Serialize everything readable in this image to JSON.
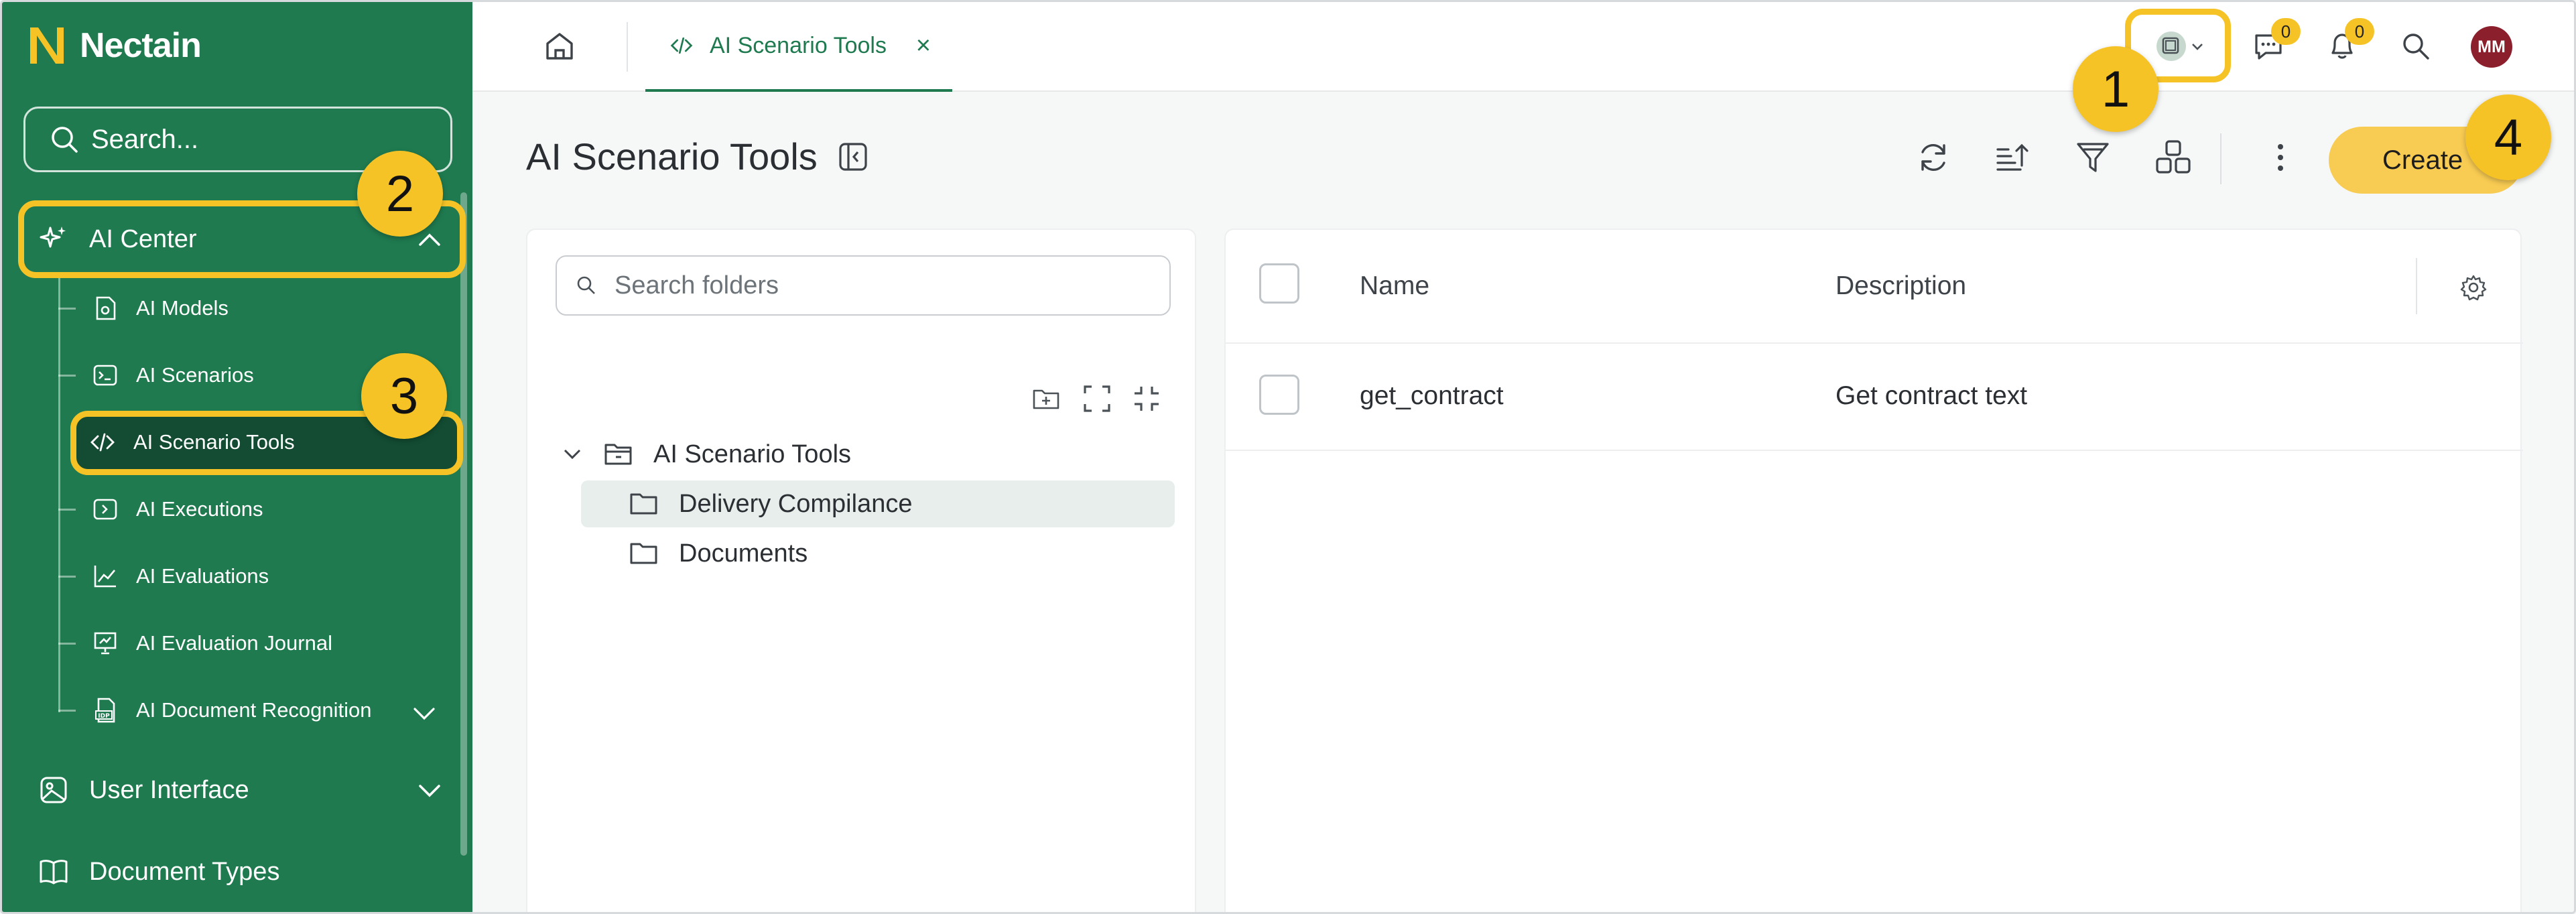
{
  "app": {
    "brand": "Nectain"
  },
  "sidebar": {
    "search_placeholder": "Search...",
    "items": [
      {
        "label": "AI Center",
        "icon": "sparkles-icon",
        "expanded": true
      },
      {
        "label": "User Interface",
        "icon": "image-icon",
        "expanded": false
      },
      {
        "label": "Document Types",
        "icon": "book-icon",
        "expanded": false
      }
    ],
    "ai_center_children": [
      {
        "label": "AI Models",
        "icon": "ai-model-icon"
      },
      {
        "label": "AI Scenarios",
        "icon": "terminal-icon"
      },
      {
        "label": "AI Scenario Tools",
        "icon": "code-icon",
        "active": true
      },
      {
        "label": "AI Executions",
        "icon": "execute-icon"
      },
      {
        "label": "AI Evaluations",
        "icon": "chart-line-icon"
      },
      {
        "label": "AI Evaluation Journal",
        "icon": "presentation-icon"
      },
      {
        "label": "AI Document Recognition",
        "icon": "idp-icon"
      }
    ]
  },
  "topbar": {
    "tab_label": "AI Scenario Tools",
    "messages_count": "0",
    "notifications_count": "0",
    "avatar_initials": "MM"
  },
  "page": {
    "title": "AI Scenario Tools",
    "create_label": "Create"
  },
  "folders": {
    "search_placeholder": "Search folders",
    "root": "AI Scenario Tools",
    "children": [
      "Delivery Compilance",
      "Documents"
    ]
  },
  "table": {
    "columns": [
      "Name",
      "Description"
    ],
    "rows": [
      {
        "name": "get_contract",
        "description": "Get contract text"
      }
    ]
  },
  "annotations": [
    "1",
    "2",
    "3",
    "4"
  ],
  "colors": {
    "sidebar": "#1f7a4f",
    "sidebar_active": "#134c32",
    "highlight": "#f6c327",
    "create_button": "#f8cb52",
    "avatar": "#8c1f2c"
  }
}
